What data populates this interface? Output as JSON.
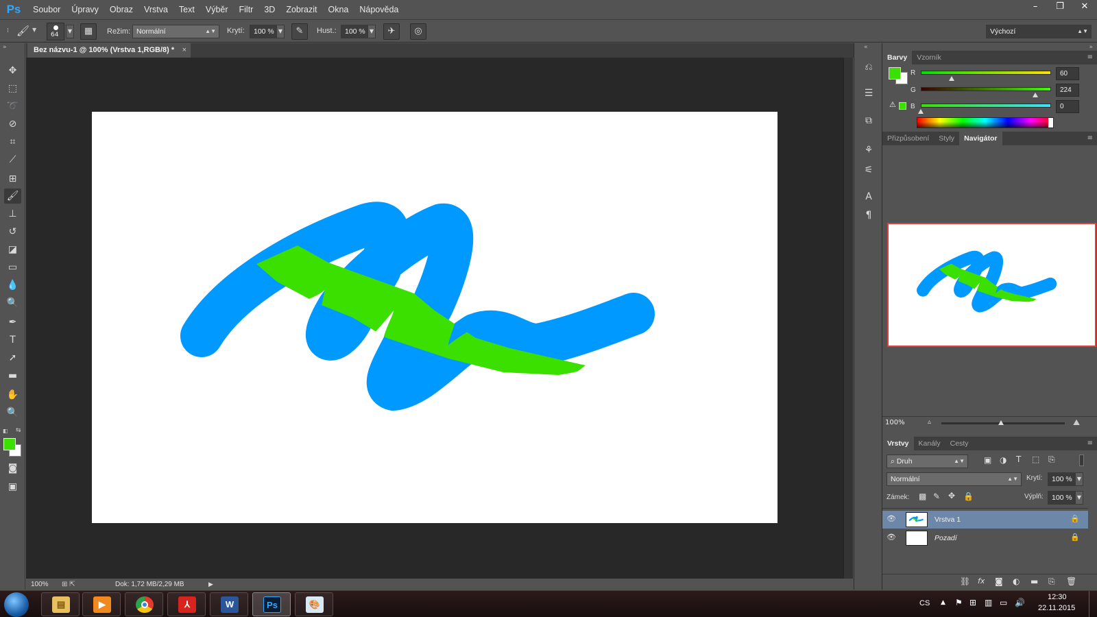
{
  "app": {
    "logo": "Ps",
    "menu": [
      "Soubor",
      "Úpravy",
      "Obraz",
      "Vrstva",
      "Text",
      "Výběr",
      "Filtr",
      "3D",
      "Zobrazit",
      "Okna",
      "Nápověda"
    ],
    "window_controls": {
      "minimize": "–",
      "restore": "❐",
      "close": "✕"
    }
  },
  "options_bar": {
    "brush_size": "64",
    "mode_label": "Režim:",
    "mode_value": "Normální",
    "opacity_label": "Krytí:",
    "opacity_value": "100 %",
    "flow_label": "Hust.:",
    "flow_value": "100 %",
    "workspace_value": "Výchozí"
  },
  "document": {
    "tab_title": "Bez názvu-1 @ 100% (Vrstva 1,RGB/8) *",
    "tab_close": "×",
    "zoom": "100%",
    "doc_info": "Dok: 1,72 MB/2,29 MB"
  },
  "colors": {
    "foreground": "#3ce000",
    "background": "#ffffff",
    "stroke_blue": "#0099ff",
    "stroke_green": "#3ce000"
  },
  "color_panel": {
    "tabs": [
      "Barvy",
      "Vzorník"
    ],
    "channels": [
      {
        "label": "R",
        "value": "60",
        "fraction": 0.235
      },
      {
        "label": "G",
        "value": "224",
        "fraction": 0.878
      },
      {
        "label": "B",
        "value": "0",
        "fraction": 0.0
      }
    ]
  },
  "navigator_panel": {
    "tabs": [
      "Přizpůsobení",
      "Styly",
      "Navigátor"
    ],
    "zoom": "100%"
  },
  "layers_panel": {
    "tabs": [
      "Vrstvy",
      "Kanály",
      "Cesty"
    ],
    "filter_label": "Druh",
    "blend_mode": "Normální",
    "opacity_label": "Krytí:",
    "opacity_value": "100 %",
    "lock_label": "Zámek:",
    "fill_label": "Výplň:",
    "fill_value": "100 %",
    "layers": [
      {
        "name": "Vrstva 1",
        "selected": true
      },
      {
        "name": "Pozadí",
        "selected": false
      }
    ]
  },
  "taskbar": {
    "language": "CS",
    "time": "12:30",
    "date": "22.11.2015"
  }
}
